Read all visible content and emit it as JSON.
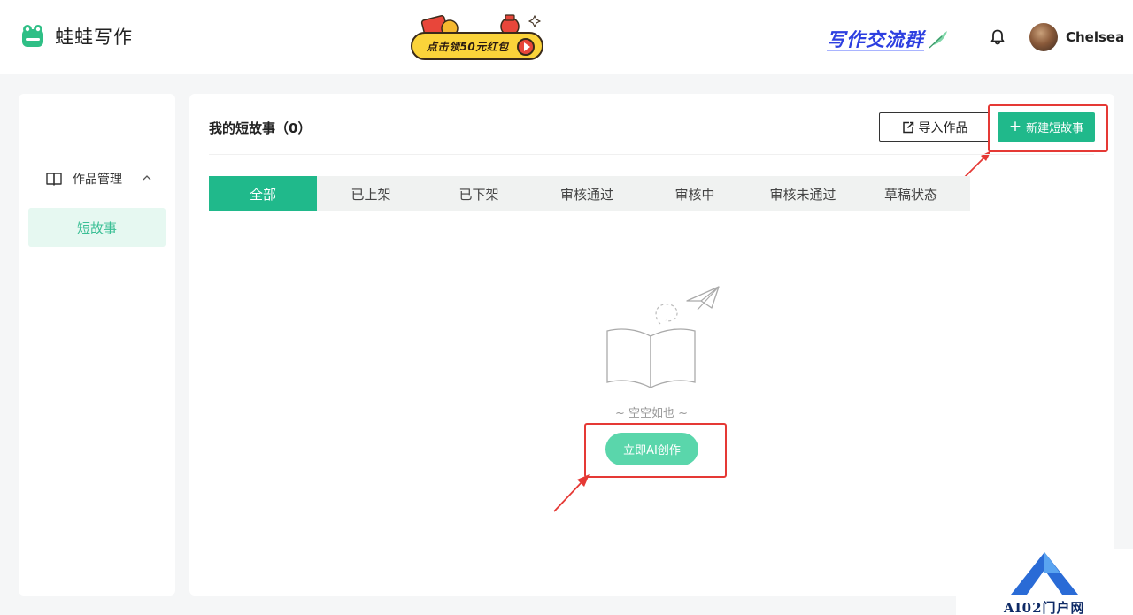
{
  "header": {
    "app_name": "蛙蛙写作",
    "promo_label": "点击领50元红包",
    "community_label": "写作交流群",
    "username": "Chelsea"
  },
  "sidebar": {
    "group_label": "作品管理",
    "active_item": "短故事"
  },
  "main": {
    "title": "我的短故事（0）",
    "import_label": "导入作品",
    "new_label": "新建短故事",
    "tabs": [
      {
        "label": "全部",
        "active": true
      },
      {
        "label": "已上架",
        "active": false
      },
      {
        "label": "已下架",
        "active": false
      },
      {
        "label": "审核通过",
        "active": false
      },
      {
        "label": "审核中",
        "active": false
      },
      {
        "label": "审核未通过",
        "active": false
      },
      {
        "label": "草稿状态",
        "active": false
      }
    ],
    "empty_text": "~ 空空如也 ~",
    "ai_button_label": "立即AI创作"
  },
  "watermark": {
    "text": "AI02门户网"
  },
  "colors": {
    "primary": "#20b98b",
    "primary_light": "#5ad6ab",
    "active_bg": "#e6f8f1",
    "highlight": "#e53935",
    "community": "#2d3fe0"
  }
}
